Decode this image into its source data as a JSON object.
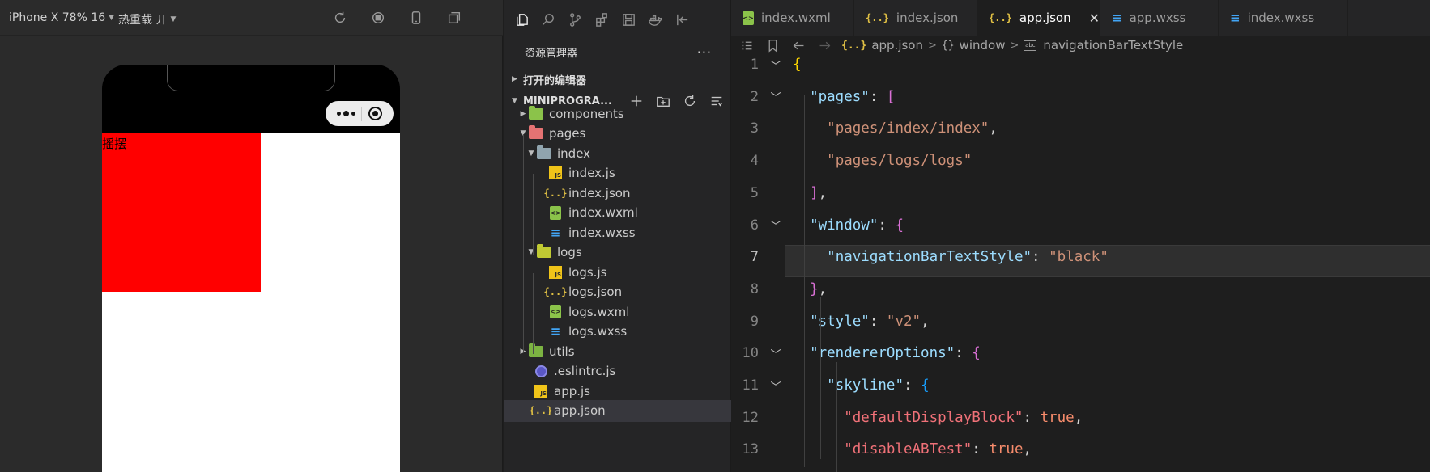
{
  "simulator": {
    "device_select": "iPhone X 78% 16",
    "hot_reload_select": "热重载 开",
    "page_text": "摇摆",
    "box_color": "#ff0000"
  },
  "explorer": {
    "title": "资源管理器",
    "more": "···",
    "open_editors": "打开的编辑器",
    "project": "MINIPROGRA...",
    "tree": [
      {
        "label": "components",
        "type": "folder",
        "color": "#8bc34a",
        "depth": 0,
        "expanded": false
      },
      {
        "label": "pages",
        "type": "folder",
        "color": "#e57373",
        "depth": 0,
        "expanded": true
      },
      {
        "label": "index",
        "type": "folder",
        "color": "#90a4ae",
        "depth": 1,
        "expanded": true
      },
      {
        "label": "index.js",
        "type": "js",
        "depth": 2
      },
      {
        "label": "index.json",
        "type": "json",
        "depth": 2
      },
      {
        "label": "index.wxml",
        "type": "wxml",
        "depth": 2
      },
      {
        "label": "index.wxss",
        "type": "wxss",
        "depth": 2
      },
      {
        "label": "logs",
        "type": "folder",
        "color": "#c0ca33",
        "depth": 1,
        "expanded": true
      },
      {
        "label": "logs.js",
        "type": "js",
        "depth": 2
      },
      {
        "label": "logs.json",
        "type": "json",
        "depth": 2
      },
      {
        "label": "logs.wxml",
        "type": "wxml",
        "depth": 2
      },
      {
        "label": "logs.wxss",
        "type": "wxss",
        "depth": 2
      },
      {
        "label": "utils",
        "type": "folder",
        "color": "#7cb342",
        "depth": 0,
        "expanded": false
      },
      {
        "label": ".eslintrc.js",
        "type": "eslint",
        "depth": 0
      },
      {
        "label": "app.js",
        "type": "js",
        "depth": 0
      },
      {
        "label": "app.json",
        "type": "json",
        "depth": 0,
        "selected": true
      }
    ]
  },
  "editor": {
    "tabs": [
      {
        "label": "index.wxml",
        "type": "wxml"
      },
      {
        "label": "index.json",
        "type": "json"
      },
      {
        "label": "app.json",
        "type": "json",
        "active": true
      },
      {
        "label": "app.wxss",
        "type": "wxss"
      },
      {
        "label": "index.wxss",
        "type": "wxss"
      }
    ],
    "breadcrumb": {
      "file": "app.json",
      "object": "window",
      "property": "navigationBarTextStyle"
    },
    "current_line": 7,
    "lines": [
      {
        "n": "1",
        "fold": true,
        "tokens": [
          [
            "b1",
            "{"
          ]
        ]
      },
      {
        "n": "2",
        "fold": true,
        "tokens": [
          [
            "p",
            "  "
          ],
          [
            "k",
            "\"pages\""
          ],
          [
            "p",
            ": "
          ],
          [
            "b2",
            "["
          ]
        ]
      },
      {
        "n": "3",
        "fold": false,
        "tokens": [
          [
            "p",
            "    "
          ],
          [
            "s",
            "\"pages/index/index\""
          ],
          [
            "p",
            ","
          ]
        ]
      },
      {
        "n": "4",
        "fold": false,
        "tokens": [
          [
            "p",
            "    "
          ],
          [
            "s",
            "\"pages/logs/logs\""
          ]
        ]
      },
      {
        "n": "5",
        "fold": false,
        "tokens": [
          [
            "p",
            "  "
          ],
          [
            "b2",
            "]"
          ],
          [
            "p",
            ","
          ]
        ]
      },
      {
        "n": "6",
        "fold": true,
        "tokens": [
          [
            "p",
            "  "
          ],
          [
            "k",
            "\"window\""
          ],
          [
            "p",
            ": "
          ],
          [
            "b2",
            "{"
          ]
        ]
      },
      {
        "n": "7",
        "fold": false,
        "tokens": [
          [
            "p",
            "    "
          ],
          [
            "k",
            "\"navigationBarTextStyle\""
          ],
          [
            "p",
            ": "
          ],
          [
            "s",
            "\"black\""
          ]
        ]
      },
      {
        "n": "8",
        "fold": false,
        "tokens": [
          [
            "p",
            "  "
          ],
          [
            "b2",
            "}"
          ],
          [
            "p",
            ","
          ]
        ]
      },
      {
        "n": "9",
        "fold": false,
        "tokens": [
          [
            "p",
            "  "
          ],
          [
            "k",
            "\"style\""
          ],
          [
            "p",
            ": "
          ],
          [
            "s",
            "\"v2\""
          ],
          [
            "p",
            ","
          ]
        ]
      },
      {
        "n": "10",
        "fold": true,
        "tokens": [
          [
            "p",
            "  "
          ],
          [
            "k",
            "\"rendererOptions\""
          ],
          [
            "p",
            ": "
          ],
          [
            "b2",
            "{"
          ]
        ]
      },
      {
        "n": "11",
        "fold": true,
        "tokens": [
          [
            "p",
            "    "
          ],
          [
            "k",
            "\"skyline\""
          ],
          [
            "p",
            ": "
          ],
          [
            "b3",
            "{"
          ]
        ]
      },
      {
        "n": "12",
        "fold": false,
        "tokens": [
          [
            "p",
            "      "
          ],
          [
            "s2",
            "\"defaultDisplayBlock\""
          ],
          [
            "p",
            ": "
          ],
          [
            "kw",
            "true"
          ],
          [
            "p",
            ","
          ]
        ]
      },
      {
        "n": "13",
        "fold": false,
        "tokens": [
          [
            "p",
            "      "
          ],
          [
            "s2",
            "\"disableABTest\""
          ],
          [
            "p",
            ": "
          ],
          [
            "kw",
            "true"
          ],
          [
            "p",
            ","
          ]
        ]
      }
    ]
  }
}
